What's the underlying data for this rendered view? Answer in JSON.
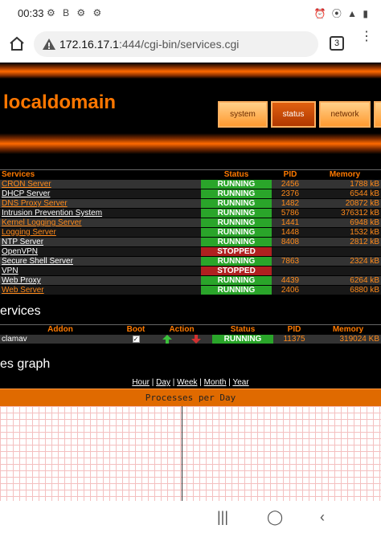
{
  "statusbar": {
    "time": "00:33",
    "notif_icons": "⚙ B ⚙ ⚙",
    "sys_icons": "⏰ ⦿ ▲ ▮"
  },
  "browser": {
    "url_host": "172.16.17.1",
    "url_rest": ":444/cgi-bin/services.cgi",
    "tab_count": "3"
  },
  "header": {
    "title": "localdomain",
    "nav": [
      "system",
      "status",
      "network"
    ]
  },
  "services": {
    "columns": [
      "Services",
      "Status",
      "PID",
      "Memory"
    ],
    "rows": [
      {
        "name": "CRON Server",
        "status": "RUNNING",
        "pid": "2456",
        "mem": "1788 kB"
      },
      {
        "name": "DHCP Server",
        "status": "RUNNING",
        "pid": "2376",
        "mem": "6544 kB"
      },
      {
        "name": "DNS Proxy Server",
        "status": "RUNNING",
        "pid": "1482",
        "mem": "20872 kB"
      },
      {
        "name": "Intrusion Prevention System",
        "status": "RUNNING",
        "pid": "5786",
        "mem": "376312 kB"
      },
      {
        "name": "Kernel Logging Server",
        "status": "RUNNING",
        "pid": "1441",
        "mem": "6948 kB"
      },
      {
        "name": "Logging Server",
        "status": "RUNNING",
        "pid": "1448",
        "mem": "1532 kB"
      },
      {
        "name": "NTP Server",
        "status": "RUNNING",
        "pid": "8408",
        "mem": "2812 kB"
      },
      {
        "name": "OpenVPN",
        "status": "STOPPED",
        "pid": "",
        "mem": ""
      },
      {
        "name": "Secure Shell Server",
        "status": "RUNNING",
        "pid": "7863",
        "mem": "2324 kB"
      },
      {
        "name": "VPN",
        "status": "STOPPED",
        "pid": "",
        "mem": ""
      },
      {
        "name": "Web Proxy",
        "status": "RUNNING",
        "pid": "4439",
        "mem": "6264 kB"
      },
      {
        "name": "Web Server",
        "status": "RUNNING",
        "pid": "2406",
        "mem": "6880 kB"
      }
    ]
  },
  "addons": {
    "heading": "ervices",
    "columns": [
      "Addon",
      "Boot",
      "Action",
      "Status",
      "PID",
      "Memory"
    ],
    "rows": [
      {
        "name": "clamav",
        "status": "RUNNING",
        "pid": "11375",
        "mem": "319024 KB"
      }
    ]
  },
  "graph_section": {
    "heading": "es graph",
    "periods": [
      "Hour",
      "Day",
      "Week",
      "Month",
      "Year"
    ],
    "graph_title": "Processes per Day"
  },
  "colors": {
    "accent": "#ff7700",
    "running": "#2aa52a",
    "stopped": "#b02020"
  }
}
